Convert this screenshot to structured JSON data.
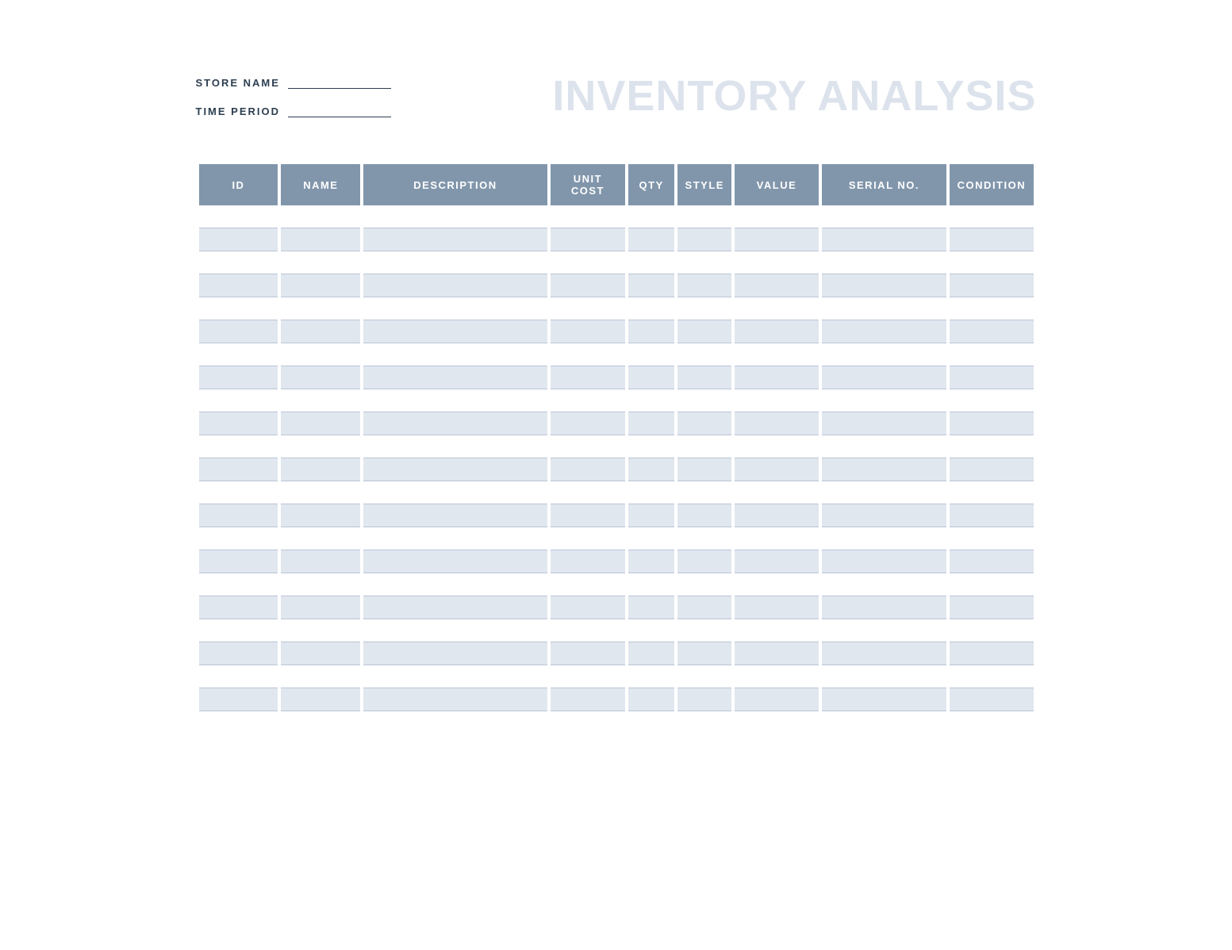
{
  "header": {
    "store_name_label": "STORE NAME",
    "store_name_value": "",
    "time_period_label": "TIME PERIOD",
    "time_period_value": "",
    "title": "INVENTORY ANALYSIS"
  },
  "table": {
    "columns": [
      {
        "key": "id",
        "label": "ID"
      },
      {
        "key": "name",
        "label": "NAME"
      },
      {
        "key": "description",
        "label": "DESCRIPTION"
      },
      {
        "key": "unit_cost",
        "label": "UNIT COST"
      },
      {
        "key": "qty",
        "label": "QTY"
      },
      {
        "key": "style",
        "label": "STYLE"
      },
      {
        "key": "value",
        "label": "VALUE"
      },
      {
        "key": "serial_no",
        "label": "SERIAL NO."
      },
      {
        "key": "condition",
        "label": "CONDITION"
      }
    ],
    "rows": [
      {
        "id": "",
        "name": "",
        "description": "",
        "unit_cost": "",
        "qty": "",
        "style": "",
        "value": "",
        "serial_no": "",
        "condition": ""
      },
      {
        "id": "",
        "name": "",
        "description": "",
        "unit_cost": "",
        "qty": "",
        "style": "",
        "value": "",
        "serial_no": "",
        "condition": ""
      },
      {
        "id": "",
        "name": "",
        "description": "",
        "unit_cost": "",
        "qty": "",
        "style": "",
        "value": "",
        "serial_no": "",
        "condition": ""
      },
      {
        "id": "",
        "name": "",
        "description": "",
        "unit_cost": "",
        "qty": "",
        "style": "",
        "value": "",
        "serial_no": "",
        "condition": ""
      },
      {
        "id": "",
        "name": "",
        "description": "",
        "unit_cost": "",
        "qty": "",
        "style": "",
        "value": "",
        "serial_no": "",
        "condition": ""
      },
      {
        "id": "",
        "name": "",
        "description": "",
        "unit_cost": "",
        "qty": "",
        "style": "",
        "value": "",
        "serial_no": "",
        "condition": ""
      },
      {
        "id": "",
        "name": "",
        "description": "",
        "unit_cost": "",
        "qty": "",
        "style": "",
        "value": "",
        "serial_no": "",
        "condition": ""
      },
      {
        "id": "",
        "name": "",
        "description": "",
        "unit_cost": "",
        "qty": "",
        "style": "",
        "value": "",
        "serial_no": "",
        "condition": ""
      },
      {
        "id": "",
        "name": "",
        "description": "",
        "unit_cost": "",
        "qty": "",
        "style": "",
        "value": "",
        "serial_no": "",
        "condition": ""
      },
      {
        "id": "",
        "name": "",
        "description": "",
        "unit_cost": "",
        "qty": "",
        "style": "",
        "value": "",
        "serial_no": "",
        "condition": ""
      },
      {
        "id": "",
        "name": "",
        "description": "",
        "unit_cost": "",
        "qty": "",
        "style": "",
        "value": "",
        "serial_no": "",
        "condition": ""
      },
      {
        "id": "",
        "name": "",
        "description": "",
        "unit_cost": "",
        "qty": "",
        "style": "",
        "value": "",
        "serial_no": "",
        "condition": ""
      },
      {
        "id": "",
        "name": "",
        "description": "",
        "unit_cost": "",
        "qty": "",
        "style": "",
        "value": "",
        "serial_no": "",
        "condition": ""
      },
      {
        "id": "",
        "name": "",
        "description": "",
        "unit_cost": "",
        "qty": "",
        "style": "",
        "value": "",
        "serial_no": "",
        "condition": ""
      },
      {
        "id": "",
        "name": "",
        "description": "",
        "unit_cost": "",
        "qty": "",
        "style": "",
        "value": "",
        "serial_no": "",
        "condition": ""
      },
      {
        "id": "",
        "name": "",
        "description": "",
        "unit_cost": "",
        "qty": "",
        "style": "",
        "value": "",
        "serial_no": "",
        "condition": ""
      },
      {
        "id": "",
        "name": "",
        "description": "",
        "unit_cost": "",
        "qty": "",
        "style": "",
        "value": "",
        "serial_no": "",
        "condition": ""
      },
      {
        "id": "",
        "name": "",
        "description": "",
        "unit_cost": "",
        "qty": "",
        "style": "",
        "value": "",
        "serial_no": "",
        "condition": ""
      },
      {
        "id": "",
        "name": "",
        "description": "",
        "unit_cost": "",
        "qty": "",
        "style": "",
        "value": "",
        "serial_no": "",
        "condition": ""
      },
      {
        "id": "",
        "name": "",
        "description": "",
        "unit_cost": "",
        "qty": "",
        "style": "",
        "value": "",
        "serial_no": "",
        "condition": ""
      },
      {
        "id": "",
        "name": "",
        "description": "",
        "unit_cost": "",
        "qty": "",
        "style": "",
        "value": "",
        "serial_no": "",
        "condition": ""
      },
      {
        "id": "",
        "name": "",
        "description": "",
        "unit_cost": "",
        "qty": "",
        "style": "",
        "value": "",
        "serial_no": "",
        "condition": ""
      }
    ]
  }
}
